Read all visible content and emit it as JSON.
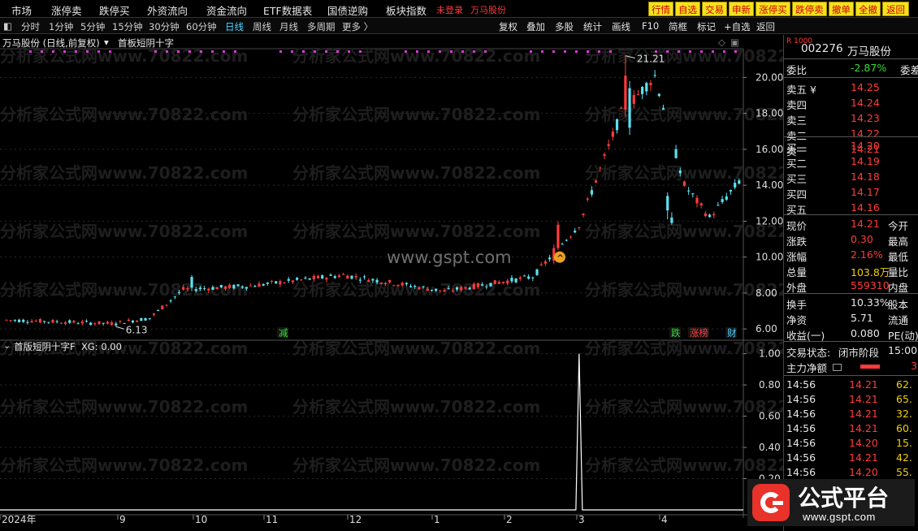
{
  "menu": {
    "items": [
      "市场",
      "涨停卖",
      "跌停买",
      "外资流向",
      "资金流向",
      "ETF数据表",
      "国债逆购",
      "板块指数"
    ],
    "login_label": "未登录",
    "stock_label": "万马股份",
    "quick_buttons": [
      "行情",
      "自选",
      "交易",
      "申新",
      "涨停买",
      "跌停卖",
      "撤单",
      "全撤",
      "返回"
    ]
  },
  "toolbar": {
    "periods": [
      "分时",
      "1分钟",
      "5分钟",
      "15分钟",
      "30分钟",
      "60分钟",
      "日线",
      "周线",
      "月线",
      "多周期",
      "更多 〉"
    ],
    "active_period": "日线",
    "actions": [
      "复权",
      "叠加",
      "多股",
      "统计",
      "画线",
      "F10",
      "简框",
      "标记",
      "+自选",
      "返回"
    ]
  },
  "chart_header": {
    "stock_title": "万马股份 (日线,前复权)",
    "formula_name": "首板短阴十字"
  },
  "watermark": {
    "main": "www.gspt.com",
    "repeat": "分析家公式网www.70822.com"
  },
  "main_chart": {
    "price_max_label": "21.21",
    "price_min_label": "6.13",
    "markers": [
      {
        "label": "减",
        "color": "#33dd33"
      },
      {
        "label": "跌",
        "color": "#33dd33"
      },
      {
        "label": "涨榜",
        "color": "#ff3b3b"
      },
      {
        "label": "财",
        "color": "#4fd3ff"
      }
    ]
  },
  "sub_chart": {
    "title": "首版短阴十字F",
    "series_label": "XG: 0.00"
  },
  "x_axis": [
    "2024年",
    "9",
    "10",
    "11",
    "12",
    "1",
    "2",
    "3",
    "4"
  ],
  "chart_data": [
    {
      "type": "candlestick",
      "title": "万马股份 (日线,前复权)",
      "y_ticks": [
        "20.00",
        "18.00",
        "16.00",
        "14.00",
        "12.00",
        "10.00",
        "8.00",
        "6.00"
      ],
      "ylim": [
        5.6,
        21.6
      ],
      "annotations": {
        "high": 21.21,
        "low": 6.13
      },
      "x_labels": [
        "2024年",
        "9",
        "10",
        "11",
        "12",
        "1",
        "2",
        "3",
        "4"
      ],
      "series_approx": [
        {
          "period": "2024-08",
          "open": 6.7,
          "close": 6.5,
          "low": 6.4,
          "high": 6.9
        },
        {
          "period": "2024-09",
          "open": 6.4,
          "close": 6.3,
          "low": 6.13,
          "high": 6.6
        },
        {
          "period": "2024-09b",
          "open": 6.4,
          "close": 6.6,
          "low": 6.3,
          "high": 6.8
        },
        {
          "period": "2024-10",
          "open": 8.9,
          "close": 8.2,
          "low": 7.6,
          "high": 9.0
        },
        {
          "period": "2024-11",
          "open": 8.0,
          "close": 8.4,
          "low": 7.6,
          "high": 8.6
        },
        {
          "period": "2024-12",
          "open": 8.6,
          "close": 9.0,
          "low": 8.3,
          "high": 9.2
        },
        {
          "period": "2025-01",
          "open": 8.5,
          "close": 8.1,
          "low": 7.6,
          "high": 8.7
        },
        {
          "period": "2025-02",
          "open": 8.4,
          "close": 8.9,
          "low": 8.1,
          "high": 9.2
        },
        {
          "period": "2025-03a",
          "open": 10.2,
          "close": 11.8,
          "low": 9.8,
          "high": 12.2
        },
        {
          "period": "2025-03b",
          "open": 16.5,
          "close": 18.0,
          "low": 15.8,
          "high": 18.4
        },
        {
          "period": "2025-03c",
          "open": 18.2,
          "close": 20.1,
          "low": 17.5,
          "high": 21.21
        },
        {
          "period": "2025-04a",
          "open": 15.5,
          "close": 14.0,
          "low": 13.6,
          "high": 15.8
        },
        {
          "period": "2025-04b",
          "open": 12.6,
          "close": 12.2,
          "low": 11.8,
          "high": 13.5
        },
        {
          "period": "2025-04c",
          "open": 13.8,
          "close": 14.21,
          "low": 13.5,
          "high": 14.6
        }
      ]
    },
    {
      "type": "line",
      "title": "首版短阴十字F",
      "y_ticks": [
        "1.00",
        "0.80",
        "0.60",
        "0.40",
        "0.20"
      ],
      "ylim": [
        0,
        1.05
      ],
      "series": [
        {
          "name": "XG",
          "note": "single spike to 1.00 in early March; 0.00 elsewhere",
          "current": 0.0,
          "peak": 1.0
        }
      ]
    }
  ],
  "quote_panel": {
    "code_badge": "R 1000",
    "code": "002276",
    "name": "万马股份",
    "webi_label": "委比",
    "webi_value": "-2.87%",
    "weicha_label": "委差",
    "asks": [
      {
        "label": "卖五 ¥",
        "price": "14.25"
      },
      {
        "label": "卖四",
        "price": "14.24"
      },
      {
        "label": "卖三",
        "price": "14.23"
      },
      {
        "label": "卖二",
        "price": "14.22"
      },
      {
        "label": "卖一",
        "price": "14.21"
      }
    ],
    "bids": [
      {
        "label": "买一",
        "price": "14.20"
      },
      {
        "label": "买二",
        "price": "14.19"
      },
      {
        "label": "买三",
        "price": "14.18"
      },
      {
        "label": "买四",
        "price": "14.17"
      },
      {
        "label": "买五",
        "price": "14.16"
      }
    ],
    "stats": [
      {
        "label": "现价",
        "value": "14.21",
        "right": "今开",
        "color": "#ff3b3b"
      },
      {
        "label": "涨跌",
        "value": "0.30",
        "right": "最高",
        "color": "#ff3b3b"
      },
      {
        "label": "涨幅",
        "value": "2.16%",
        "right": "最低",
        "color": "#ff3b3b"
      },
      {
        "label": "总量",
        "value": "103.8万",
        "right": "量比",
        "color": "#f0d000"
      },
      {
        "label": "外盘",
        "value": "559310",
        "right": "内盘",
        "color": "#ff3b3b"
      }
    ],
    "stats2": [
      {
        "label": "换手",
        "value": "10.33%",
        "right": "股本"
      },
      {
        "label": "净资",
        "value": "5.71",
        "right": "流通"
      },
      {
        "label": "收益(一)",
        "value": "0.080",
        "right": "PE(动)"
      }
    ],
    "trade_status_label": "交易状态:",
    "trade_status": "闭市阶段",
    "trade_time": "15:00",
    "main_flow_label": "主力净额",
    "main_flow_value": "3",
    "ticks": [
      {
        "time": "14:56",
        "price": "14.21",
        "vol": "62."
      },
      {
        "time": "14:56",
        "price": "14.21",
        "vol": "65."
      },
      {
        "time": "14:56",
        "price": "14.21",
        "vol": "32."
      },
      {
        "time": "14:56",
        "price": "14.21",
        "vol": "60."
      },
      {
        "time": "14:56",
        "price": "14.20",
        "vol": "15."
      },
      {
        "time": "14:56",
        "price": "14.21",
        "vol": "42."
      },
      {
        "time": "14:56",
        "price": "14.20",
        "vol": "55."
      }
    ]
  },
  "brand": {
    "name": "公式平台",
    "url": "www.gspt.com"
  },
  "colors": {
    "up": "#ff3b3b",
    "down": "#5ce1f0",
    "grid": "#2a2a2a",
    "formula_dot": "#d23cd2",
    "brand_red": "#e8322a"
  }
}
